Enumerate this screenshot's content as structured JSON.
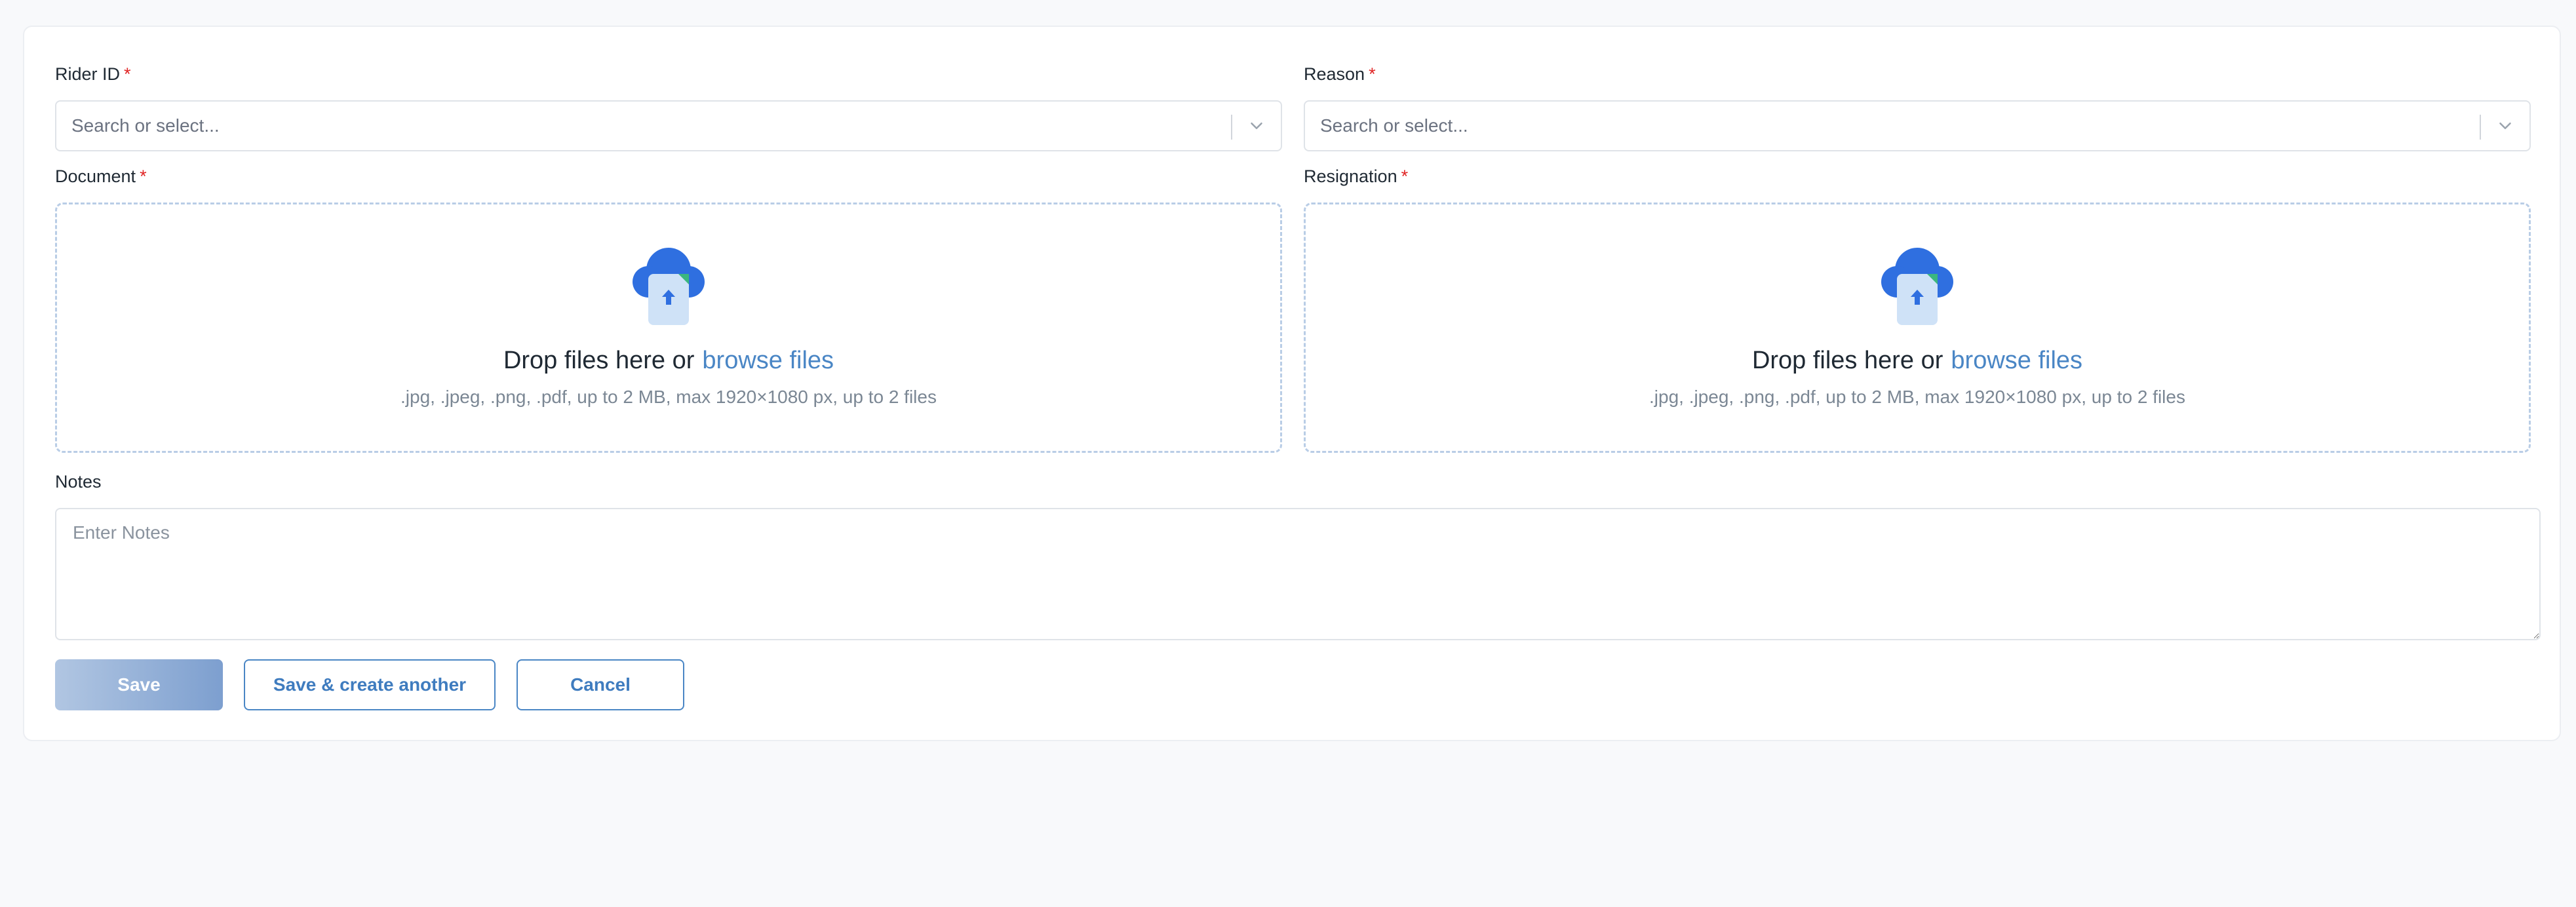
{
  "form": {
    "rider_id": {
      "label": "Rider ID",
      "required_mark": "*",
      "placeholder": "Search or select..."
    },
    "reason": {
      "label": "Reason",
      "required_mark": "*",
      "placeholder": "Search or select..."
    },
    "document": {
      "label": "Document",
      "required_mark": "*",
      "drop_text": "Drop files here or",
      "browse_text": "browse files",
      "hint": ".jpg, .jpeg, .png, .pdf, up to 2 MB, max 1920×1080 px, up to 2 files"
    },
    "resignation": {
      "label": "Resignation",
      "required_mark": "*",
      "drop_text": "Drop files here or",
      "browse_text": "browse files",
      "hint": ".jpg, .jpeg, .png, .pdf, up to 2 MB, max 1920×1080 px, up to 2 files"
    },
    "notes": {
      "label": "Notes",
      "placeholder": "Enter Notes",
      "value": ""
    }
  },
  "actions": {
    "save_label": "Save",
    "save_another_label": "Save & create another",
    "cancel_label": "Cancel"
  },
  "icons": {
    "select_chevron": "chevron-down-icon",
    "upload": "cloud-upload-icon"
  },
  "colors": {
    "accent": "#4a86c5",
    "required": "#e02424",
    "dropzone_border": "#b9cde6",
    "save_gradient_start": "#b1c6e2",
    "save_gradient_end": "#7d9fcf"
  }
}
